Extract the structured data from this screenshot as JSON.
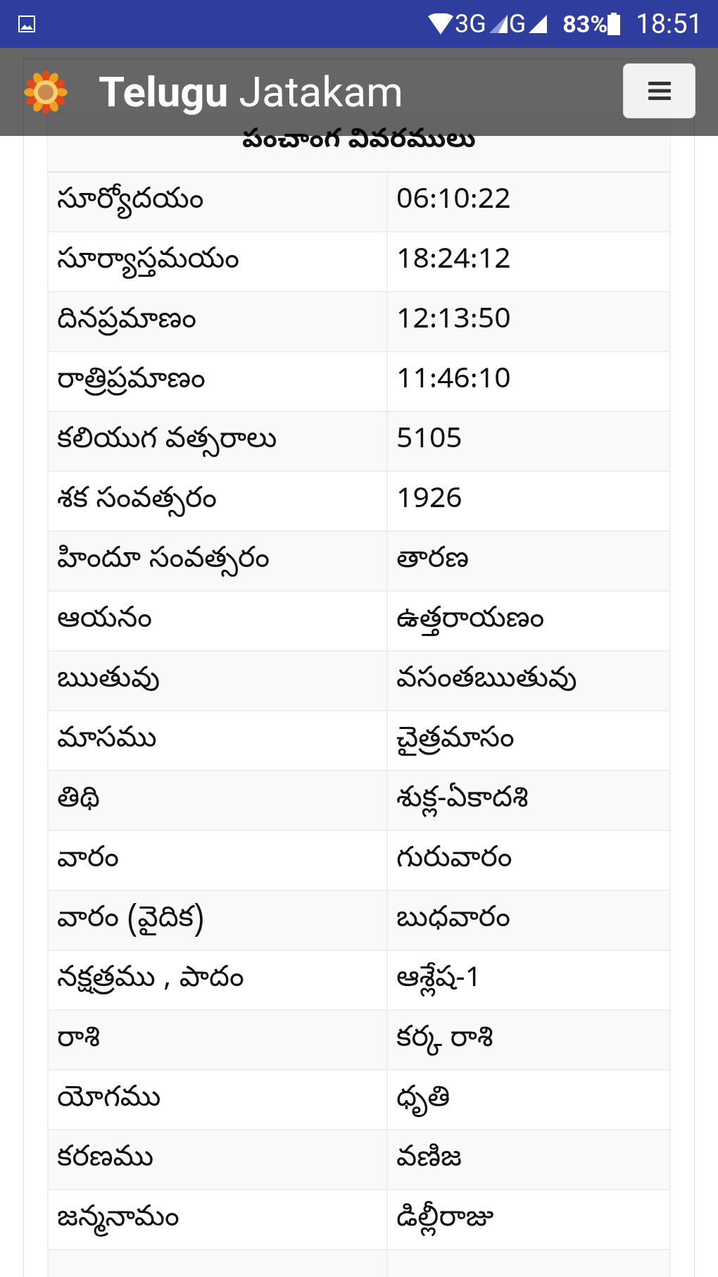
{
  "status_bar": {
    "network": [
      "3G",
      "G"
    ],
    "battery": "83%",
    "time": "18:51"
  },
  "header": {
    "title_bold": "Telugu",
    "title_rest": "Jatakam"
  },
  "table": {
    "heading": "పంచాంగ వివరములు",
    "rows": [
      {
        "label": "సూర్యోదయం",
        "value": "06:10:22"
      },
      {
        "label": "సూర్యాస్తమయం",
        "value": "18:24:12"
      },
      {
        "label": "దినప్రమాణం",
        "value": "12:13:50"
      },
      {
        "label": "రాత్రిప్రమాణం",
        "value": "11:46:10"
      },
      {
        "label": "కలియుగ వత్సరాలు",
        "value": "5105"
      },
      {
        "label": "శక సంవత్సరం",
        "value": "1926"
      },
      {
        "label": "హిందూ సంవత్సరం",
        "value": "తారణ"
      },
      {
        "label": "ఆయనం",
        "value": "ఉత్తరాయణం"
      },
      {
        "label": "ఋతువు",
        "value": "వసంతఋతువు"
      },
      {
        "label": "మాసము",
        "value": "చైత్రమాసం"
      },
      {
        "label": "తిథి",
        "value": "శుక్ల-ఏకాదశి"
      },
      {
        "label": "వారం",
        "value": "గురువారం"
      },
      {
        "label": "వారం (వైదిక)",
        "value": "బుధవారం"
      },
      {
        "label": "నక్షత్రము , పాదం",
        "value": "ఆశ్లేష-1"
      },
      {
        "label": "రాశి",
        "value": "కర్క రాశి"
      },
      {
        "label": "యోగము",
        "value": "ధృతి"
      },
      {
        "label": "కరణము",
        "value": "వణిజ"
      },
      {
        "label": "జన్మనామం",
        "value": "డిల్లీరాజు"
      }
    ]
  }
}
